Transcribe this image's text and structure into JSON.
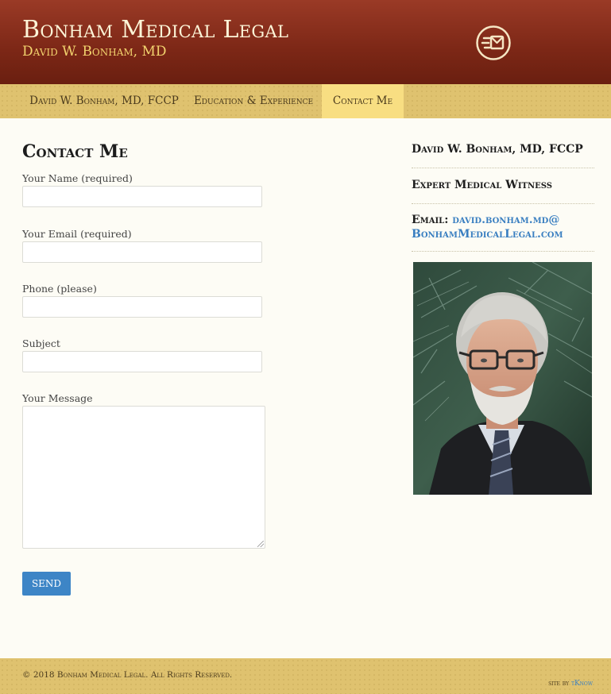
{
  "header": {
    "title": "Bonham Medical Legal",
    "subtitle": "David W. Bonham, MD",
    "icon": "mail-icon"
  },
  "nav": {
    "items": [
      {
        "label": "David W. Bonham, MD, FCCP"
      },
      {
        "label": "Education & Experience"
      },
      {
        "label": "Contact Me",
        "active": true
      }
    ]
  },
  "main": {
    "title": "Contact Me",
    "form": {
      "name_label": "Your Name (required)",
      "email_label": "Your Email (required)",
      "phone_label": "Phone (please)",
      "subject_label": "Subject",
      "message_label": "Your Message",
      "name_value": "",
      "email_value": "",
      "phone_value": "",
      "subject_value": "",
      "message_value": "",
      "send_label": "SEND"
    }
  },
  "sidebar": {
    "name": "David W. Bonham, MD, FCCP",
    "role": "Expert Medical Witness",
    "email_label": "Email:",
    "email_line1": "david.bonham.md@",
    "email_line2": "BonhamMedicalLegal.com"
  },
  "footer": {
    "copyright": "© 2018 Bonham Medical Legal. All Rights Reserved.",
    "credit_prefix": "site by",
    "credit_link": "tKnow"
  },
  "colors": {
    "header_dark": "#7c2716",
    "nav_gold": "#dfc26f",
    "nav_active": "#f8de82",
    "link_blue": "#3a7fc1",
    "button_blue": "#3d85c6"
  }
}
